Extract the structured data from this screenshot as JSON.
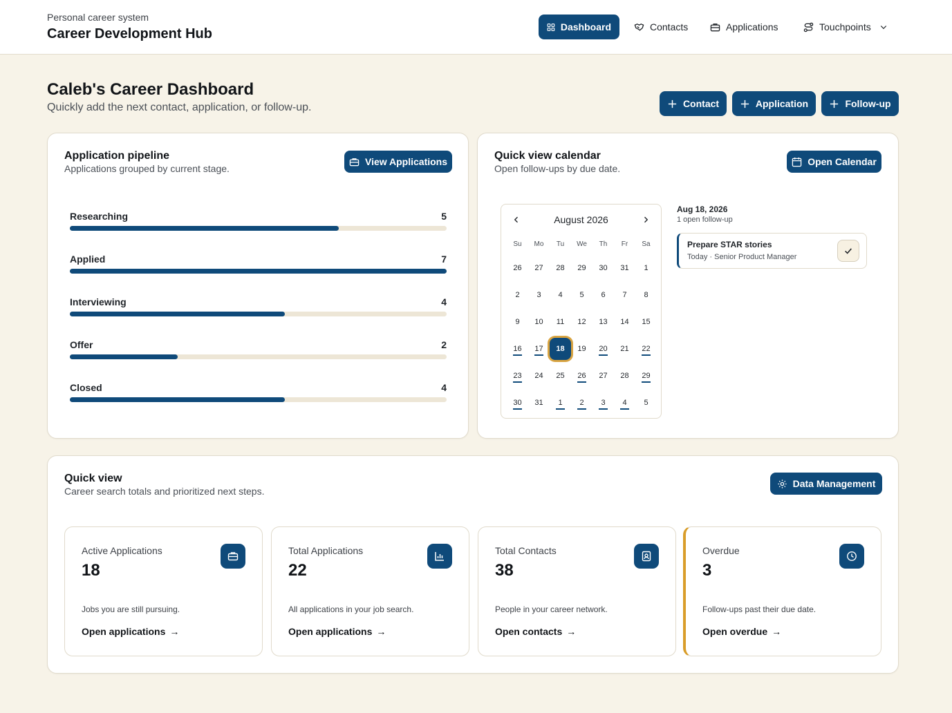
{
  "header": {
    "subtitle": "Personal career system",
    "title": "Career Development Hub",
    "nav": {
      "dashboard": "Dashboard",
      "contacts": "Contacts",
      "applications": "Applications",
      "touchpoints": "Touchpoints"
    }
  },
  "page": {
    "title": "Caleb's Career Dashboard",
    "subtitle": "Quickly add the next contact, application, or follow-up.",
    "actions": {
      "contact": "Contact",
      "application": "Application",
      "followup": "Follow-up"
    }
  },
  "pipeline": {
    "title": "Application pipeline",
    "subtitle": "Applications grouped by current stage.",
    "button": "View Applications",
    "stages": [
      {
        "label": "Researching",
        "count": "5",
        "fraction": 0.714
      },
      {
        "label": "Applied",
        "count": "7",
        "fraction": 1.0
      },
      {
        "label": "Interviewing",
        "count": "4",
        "fraction": 0.571
      },
      {
        "label": "Offer",
        "count": "2",
        "fraction": 0.286
      },
      {
        "label": "Closed",
        "count": "4",
        "fraction": 0.571
      }
    ]
  },
  "calendar": {
    "title": "Quick view calendar",
    "subtitle": "Open follow-ups by due date.",
    "button": "Open Calendar",
    "month": "August 2026",
    "weekdays": [
      "Su",
      "Mo",
      "Tu",
      "We",
      "Th",
      "Fr",
      "Sa"
    ],
    "days": [
      {
        "d": "26"
      },
      {
        "d": "27"
      },
      {
        "d": "28"
      },
      {
        "d": "29"
      },
      {
        "d": "30"
      },
      {
        "d": "31"
      },
      {
        "d": "1"
      },
      {
        "d": "2"
      },
      {
        "d": "3"
      },
      {
        "d": "4"
      },
      {
        "d": "5"
      },
      {
        "d": "6"
      },
      {
        "d": "7"
      },
      {
        "d": "8"
      },
      {
        "d": "9"
      },
      {
        "d": "10"
      },
      {
        "d": "11"
      },
      {
        "d": "12"
      },
      {
        "d": "13"
      },
      {
        "d": "14"
      },
      {
        "d": "15"
      },
      {
        "d": "16",
        "has": true
      },
      {
        "d": "17",
        "has": true
      },
      {
        "d": "18",
        "selected": true
      },
      {
        "d": "19"
      },
      {
        "d": "20",
        "has": true
      },
      {
        "d": "21"
      },
      {
        "d": "22",
        "has": true
      },
      {
        "d": "23",
        "has": true
      },
      {
        "d": "24"
      },
      {
        "d": "25"
      },
      {
        "d": "26",
        "has": true
      },
      {
        "d": "27"
      },
      {
        "d": "28"
      },
      {
        "d": "29",
        "has": true
      },
      {
        "d": "30",
        "has": true
      },
      {
        "d": "31"
      },
      {
        "d": "1",
        "has": true
      },
      {
        "d": "2",
        "has": true
      },
      {
        "d": "3",
        "has": true
      },
      {
        "d": "4",
        "has": true
      },
      {
        "d": "5"
      }
    ],
    "agenda": {
      "date": "Aug 18, 2026",
      "count": "1 open follow-up",
      "item_title": "Prepare STAR stories",
      "item_meta": "Today · Senior Product Manager"
    }
  },
  "quickview": {
    "title": "Quick view",
    "subtitle": "Career search totals and prioritized next steps.",
    "button": "Data Management",
    "stats": [
      {
        "label": "Active Applications",
        "value": "18",
        "desc": "Jobs you are still pursuing.",
        "link": "Open applications",
        "icon": "briefcase-icon"
      },
      {
        "label": "Total Applications",
        "value": "22",
        "desc": "All applications in your job search.",
        "link": "Open applications",
        "icon": "bar-chart-icon"
      },
      {
        "label": "Total Contacts",
        "value": "38",
        "desc": "People in your career network.",
        "link": "Open contacts",
        "icon": "contact-card-icon"
      },
      {
        "label": "Overdue",
        "value": "3",
        "desc": "Follow-ups past their due date.",
        "link": "Open overdue",
        "icon": "clock-icon"
      }
    ]
  },
  "colors": {
    "primary": "#0f4a7a",
    "background": "#f7f3e8",
    "accent": "#d99d2a",
    "track": "#ede6d6"
  }
}
